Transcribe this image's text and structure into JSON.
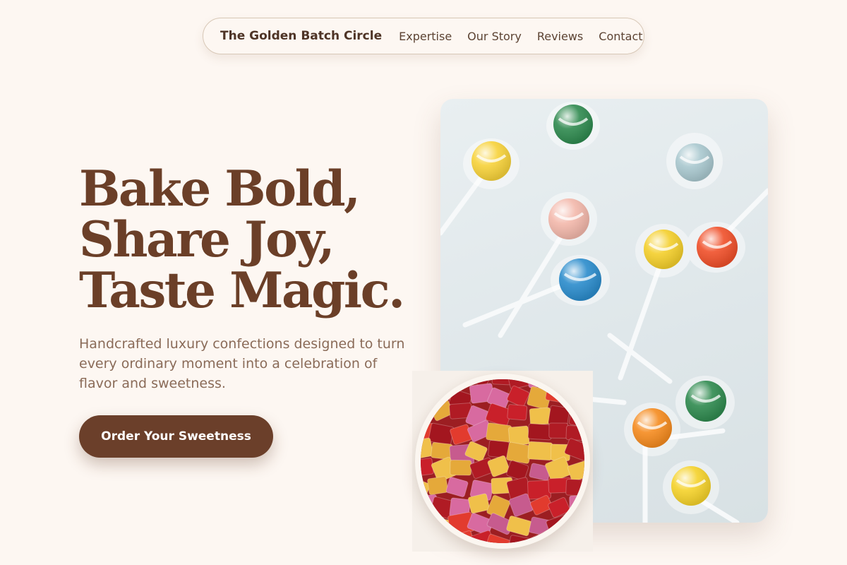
{
  "nav": {
    "brand": "The Golden Batch Circle",
    "links": [
      "Expertise",
      "Our Story",
      "Reviews",
      "Contact"
    ]
  },
  "hero": {
    "headline": [
      "Bake Bold,",
      "Share Joy,",
      "Taste Magic."
    ],
    "subtitle": "Handcrafted luxury confections designed to turn every ordinary moment into a celebration of flavor and sweetness.",
    "cta_label": "Order Your Sweetness"
  },
  "colors": {
    "background": "#fdf7f2",
    "brand_brown": "#6b3f28",
    "button": "#6b3f2a",
    "body_text": "#8a6b58"
  }
}
